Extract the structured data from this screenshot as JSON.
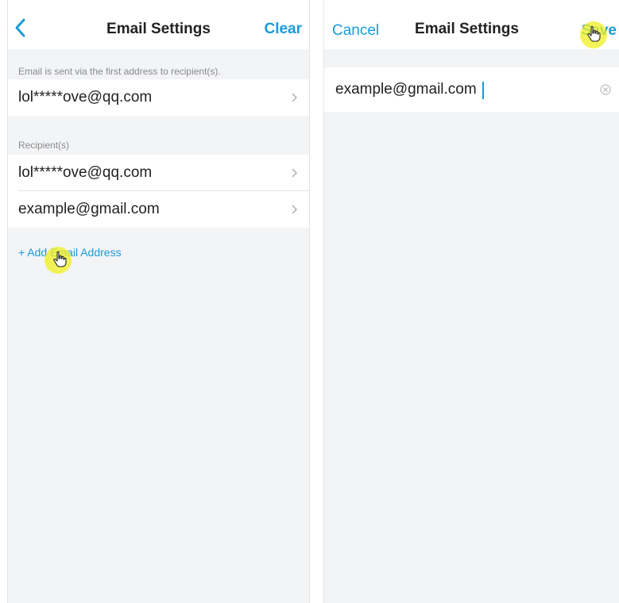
{
  "left_screen": {
    "title": "Email Settings",
    "back_icon": "chevron-left-icon",
    "clear_label": "Clear",
    "sender_hint": "Email is sent via the first address to recipient(s).",
    "sender_address": "lol*****ove@qq.com",
    "recipients_label": "Recipient(s)",
    "recipients": [
      {
        "address": "lol*****ove@qq.com"
      },
      {
        "address": "example@gmail.com"
      }
    ],
    "add_label": "+ Add Email Address"
  },
  "right_screen": {
    "cancel_label": "Cancel",
    "title": "Email Settings",
    "save_label": "Save",
    "email_value": "example@gmail.com",
    "clear_icon": "circle-x-icon"
  },
  "colors": {
    "accent": "#1a9bd7",
    "background": "#f3f4f6",
    "surface": "#ffffff",
    "cursor_highlight": "#f0f028"
  }
}
